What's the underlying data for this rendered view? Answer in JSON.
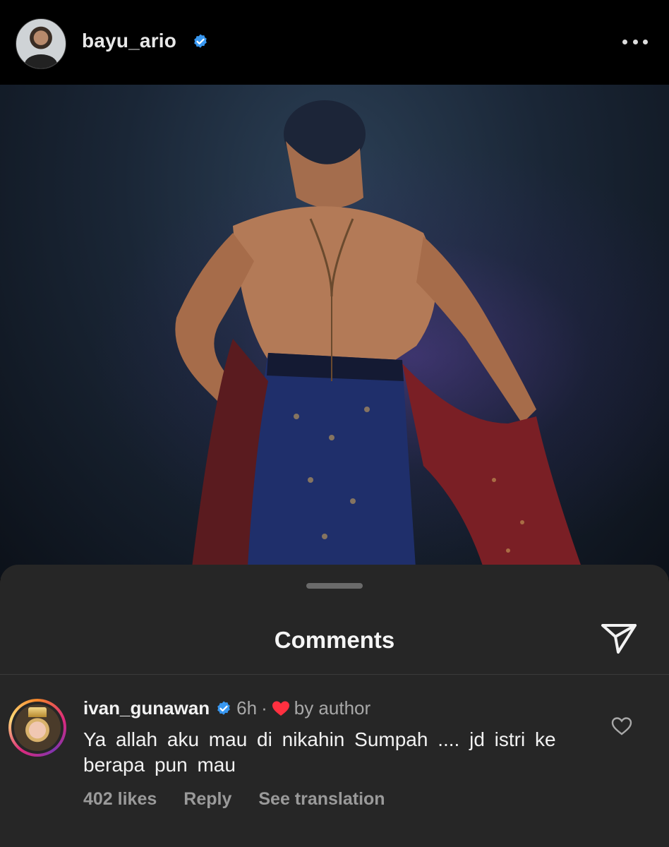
{
  "header": {
    "username": "bayu_ario",
    "verified": true,
    "avatar_icon": "profile-avatar",
    "more_icon": "more-horizontal-icon"
  },
  "post": {
    "image_description_icon": "post-photo"
  },
  "comments_sheet": {
    "title": "Comments",
    "share_icon": "send-icon"
  },
  "comment": {
    "username": "ivan_gunawan",
    "verified": true,
    "time": "6h",
    "separator": "·",
    "author_label": "by author",
    "text": "Ya allah aku mau di nikahin Sumpah .... jd istri ke berapa pun mau",
    "likes": "402 likes",
    "reply": "Reply",
    "translate": "See translation"
  },
  "colors": {
    "background": "#000000",
    "sheet": "#262626",
    "verified_blue": "#3897f0",
    "heart_red": "#ff3040"
  }
}
